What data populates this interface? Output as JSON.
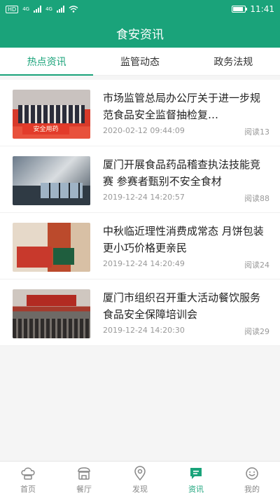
{
  "status": {
    "left_icons": [
      "sim-icon",
      "signal-icon",
      "signal-icon",
      "wifi-icon"
    ],
    "sim_label": "HD",
    "network1": "4G",
    "network2": "4G",
    "battery_level": 0.85,
    "time": "11:41"
  },
  "header": {
    "title": "食安资讯"
  },
  "tabs": [
    {
      "label": "热点资讯",
      "active": true
    },
    {
      "label": "监管动态",
      "active": false
    },
    {
      "label": "政务法规",
      "active": false
    }
  ],
  "news": [
    {
      "title": "市场监管总局办公厅关于进一步规范食品安全监督抽检复…",
      "date": "2020-02-12 09:44:09",
      "reads": "阅读13",
      "thumb_text": "安全用药"
    },
    {
      "title": "厦门开展食品药品稽查执法技能竞赛 参赛者甄别不安全食材",
      "date": "2019-12-24 14:20:57",
      "reads": "阅读88"
    },
    {
      "title": "中秋临近理性消费成常态 月饼包装更小巧价格更亲民",
      "date": "2019-12-24 14:20:49",
      "reads": "阅读24"
    },
    {
      "title": "厦门市组织召开重大活动餐饮服务食品安全保障培训会",
      "date": "2019-12-24 14:20:30",
      "reads": "阅读29"
    }
  ],
  "bottom_nav": [
    {
      "label": "首页",
      "icon": "chef-hat-icon",
      "active": false
    },
    {
      "label": "餐厅",
      "icon": "restaurant-icon",
      "active": false
    },
    {
      "label": "发现",
      "icon": "location-pin-icon",
      "active": false
    },
    {
      "label": "资讯",
      "icon": "message-icon",
      "active": true
    },
    {
      "label": "我的",
      "icon": "smile-face-icon",
      "active": false
    }
  ],
  "colors": {
    "accent": "#1aa37a"
  }
}
